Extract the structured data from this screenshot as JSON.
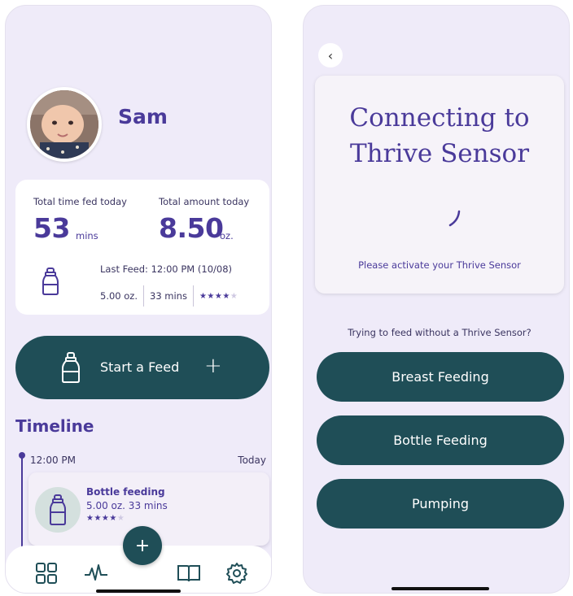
{
  "dashboard": {
    "baby_name": "Sam",
    "stats": {
      "time_label": "Total time fed today",
      "time_value": "53",
      "time_unit": "mins",
      "amount_label": "Total amount today",
      "amount_value": "8.50",
      "amount_unit": "oz."
    },
    "last_feed": {
      "label": "Last Feed: 12:00 PM (10/08)",
      "amount": "5.00 oz.",
      "duration": "33  mins",
      "rating": 4,
      "rating_max": 5
    },
    "start_feed_label": "Start a Feed",
    "start_feed_plus": "+",
    "timeline": {
      "title": "Timeline",
      "time": "12:00 PM",
      "day": "Today",
      "entry": {
        "title": "Bottle feeding",
        "meta": "5.00 oz.  33 mins",
        "rating": 4,
        "rating_max": 5
      }
    },
    "fab_label": "+",
    "nav": {
      "items": [
        "dashboard",
        "activity",
        "journal",
        "settings"
      ]
    }
  },
  "connect": {
    "back_glyph": "‹",
    "title_line1": "Connecting to",
    "title_line2": "Thrive Sensor",
    "activate_text": "Please activate your Thrive Sensor",
    "trying_text": "Trying to feed without a Thrive Sensor?",
    "buttons": [
      "Breast Feeding",
      "Bottle Feeding",
      "Pumping"
    ]
  },
  "colors": {
    "background": "#efebf9",
    "accent_purple": "#4a3a9a",
    "button_teal": "#1f4e57",
    "card_white": "#ffffff"
  }
}
